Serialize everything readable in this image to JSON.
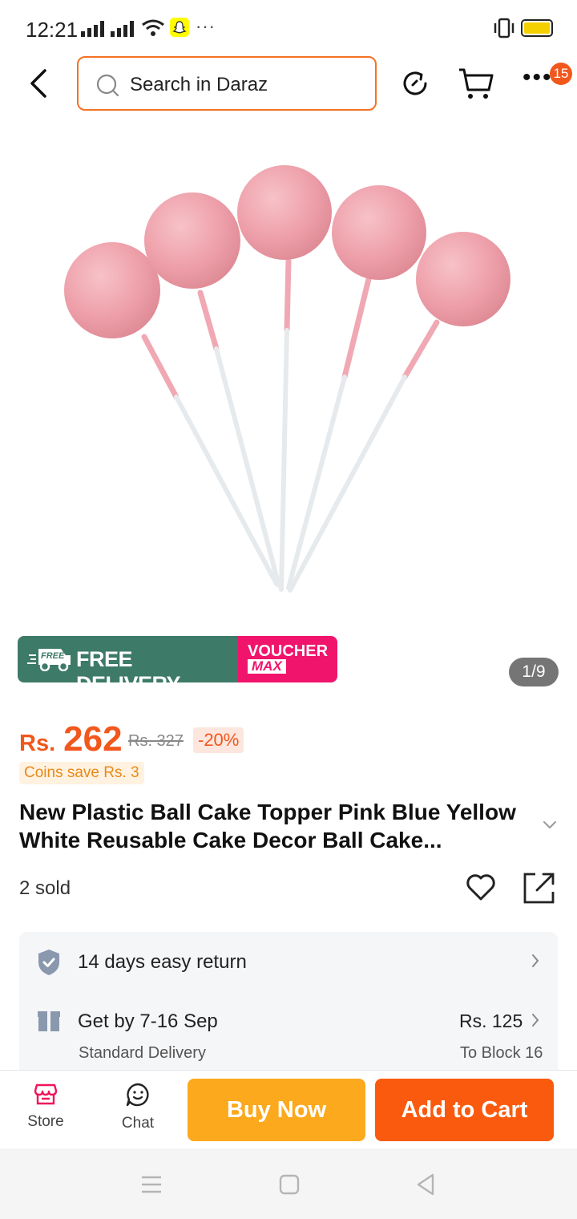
{
  "status_bar": {
    "time": "12:21",
    "more": "···"
  },
  "header": {
    "search_placeholder": "Search in Daraz",
    "more": "•••",
    "notification_count": "15"
  },
  "gallery": {
    "counter": "1/9"
  },
  "promo": {
    "badge_word": "FREE",
    "free_delivery": "FREE DELIVERY",
    "voucher": "VOUCHER",
    "max": "MAX"
  },
  "price": {
    "currency": "Rs.",
    "amount": "262",
    "original": "Rs. 327",
    "discount": "-20%",
    "coins": "Coins save Rs. 3"
  },
  "product": {
    "title": "New Plastic Ball Cake Topper Pink Blue Yellow White Reusable Cake Decor Ball Cake...",
    "sold": "2 sold"
  },
  "services": {
    "return": "14 days easy return",
    "delivery": "Get by 7-16 Sep",
    "delivery_type": "Standard Delivery",
    "fee": "Rs. 125",
    "destination": "To Block 16"
  },
  "actions": {
    "store": "Store",
    "chat": "Chat",
    "buy_now": "Buy Now",
    "add_to_cart": "Add to Cart"
  },
  "colors": {
    "brand_orange": "#f57224",
    "price_orange": "#f2571c",
    "buy_now": "#fca91e",
    "add_to_cart": "#fa5a0d",
    "delivery_green": "#3d7a67",
    "voucher_pink": "#f0146c"
  }
}
